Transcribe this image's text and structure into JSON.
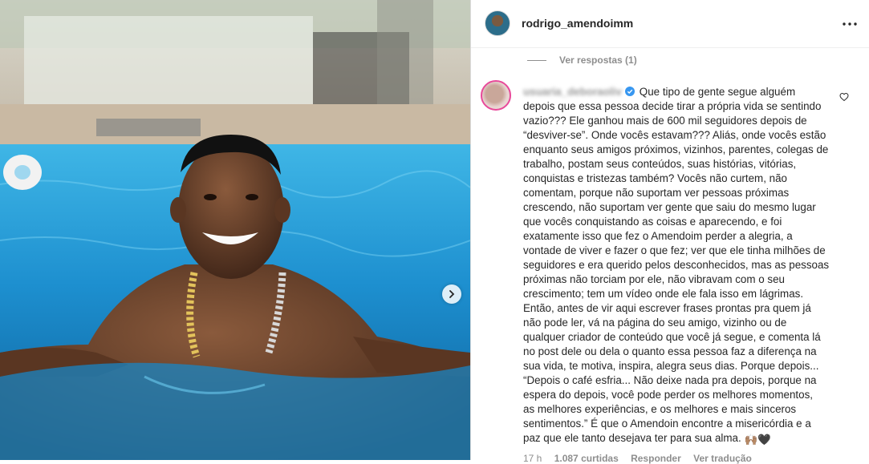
{
  "post": {
    "author": "rodrigo_amendoimm",
    "more_icon": "more-horizontal-icon"
  },
  "media": {
    "next_icon": "chevron-right-icon"
  },
  "comments": {
    "view_replies": "Ver respostas (1)",
    "item": {
      "username": "usuaria_deboraoliv",
      "verified": true,
      "text": "Que tipo de gente segue alguém\ndepois que essa pessoa decide tirar a própria vida se sentindo\nvazio??? Ele ganhou mais de 600 mil seguidores depois de\n“desviver-se”. Onde vocês estavam??? Aliás, onde vocês estão\nenquanto seus amigos próximos, vizinhos, parentes, colegas de\ntrabalho, postam seus conteúdos, suas histórias, vitórias,\nconquistas e tristezas também? Vocês não curtem, não\ncomentam, porque não suportam ver pessoas próximas\ncrescendo, não suportam ver gente que saiu do mesmo lugar\nque vocês conquistando as coisas e aparecendo, e foi\nexatamente isso que fez o Amendoim perder a alegria, a\nvontade de viver e fazer o que fez; ver que ele tinha milhões de\nseguidores e era querido pelos desconhecidos, mas as pessoas\npróximas não torciam por ele, não vibravam com o seu\ncrescimento; tem um vídeo onde ele fala isso em lágrimas.\nEntão, antes de vir aqui escrever frases prontas pra quem já\nnão pode ler, vá na página do seu amigo, vizinho ou de\nqualquer criador de conteúdo que você já segue, e comenta lá\nno post dele ou dela o quanto essa pessoa faz a diferença na\nsua vida, te motiva, inspira, alegra seus dias. Porque depois...\n“Depois o café esfria... Não deixe nada pra depois, porque na\nespera do depois, você pode perder os melhores momentos,\nas melhores experiências, e os melhores e mais sinceros\nsentimentos.” É que o Amendoin encontre a misericórdia e a\npaz que ele tanto desejava ter para sua alma. ",
      "emoji_1": "🙌🏽",
      "emoji_2": "🖤",
      "time": "17 h",
      "likes": "1.087 curtidas",
      "reply": "Responder",
      "translation": "Ver tradução"
    }
  },
  "colors": {
    "pool": "#1f8fc9",
    "verified": "#3897f0",
    "muted_text": "#8e8e8e"
  }
}
